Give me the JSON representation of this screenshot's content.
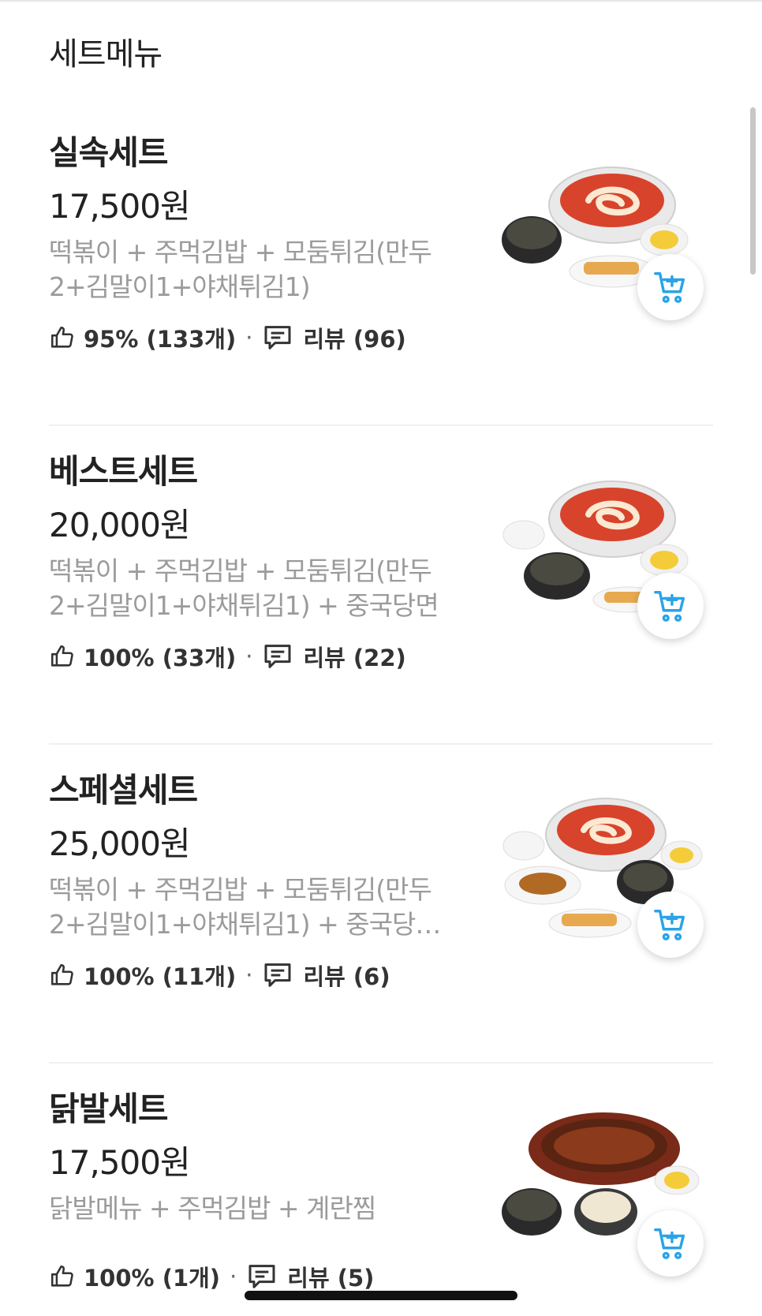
{
  "section": {
    "title": "세트메뉴"
  },
  "items": [
    {
      "name": "실속세트",
      "price": "17,500원",
      "desc": "떡볶이 + 주먹김밥 + 모둠튀김(만두2+김말이1+야채튀김1)",
      "like": "95% (133개)",
      "review": "리뷰 (96)",
      "image_icon": "set-meal-photo"
    },
    {
      "name": "베스트세트",
      "price": "20,000원",
      "desc": "떡볶이 + 주먹김밥 + 모둠튀김(만두2+김말이1+야채튀김1) + 중국당면",
      "like": "100% (33개)",
      "review": "리뷰 (22)",
      "image_icon": "set-meal-photo"
    },
    {
      "name": "스페셜세트",
      "price": "25,000원",
      "desc": "떡볶이 + 주먹김밥 + 모둠튀김(만두2+김말이1+야채튀김1) + 중국당…",
      "like": "100% (11개)",
      "review": "리뷰 (6)",
      "image_icon": "set-meal-photo"
    },
    {
      "name": "닭발세트",
      "price": "17,500원",
      "desc": "닭발메뉴 + 주먹김밥 + 계란찜",
      "like": "100% (1개)",
      "review": "리뷰 (5)",
      "image_icon": "chicken-feet-set-photo"
    }
  ],
  "icons": {
    "like": "thumbs-up-icon",
    "review": "speech-bubble-icon",
    "cart": "cart-add-icon"
  },
  "colors": {
    "accent": "#2aa3e8",
    "text": "#222222",
    "desc": "#9b9b9b",
    "divider": "#f0f0f0"
  }
}
